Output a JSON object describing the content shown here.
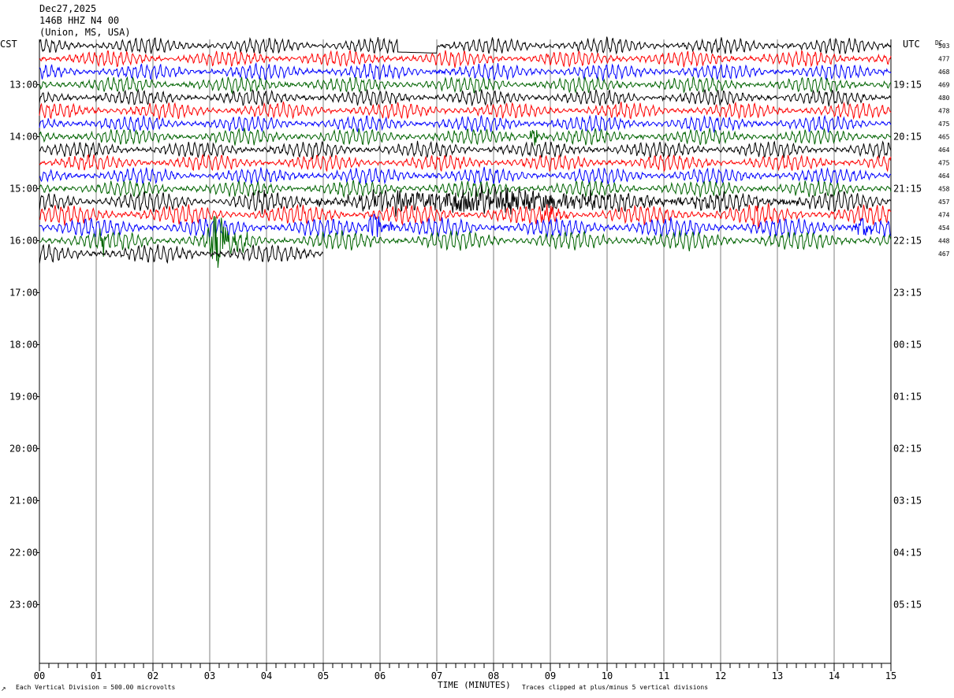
{
  "header": {
    "date": "Dec27,2025",
    "station": "146B HHZ N4 00",
    "location": "(Union, MS, USA)"
  },
  "left_axis_label": "CST",
  "right_axis_label": "UTC",
  "dc_label": "DC",
  "footer": {
    "scale_note": "Each Vertical Division =  500.00 microvolts",
    "clip_note": "Traces clipped at plus/minus 5 vertical divisions",
    "xlabel": "TIME (MINUTES)",
    "corner_mark": "↗"
  },
  "colors": {
    "trace_cycle": [
      "#000000",
      "#ff0000",
      "#0000ff",
      "#006400"
    ],
    "grid": "#808080",
    "text": "#000000"
  },
  "chart_data": {
    "type": "line",
    "title": "Dec27,2025 146B HHZ N4 00 (Union, MS, USA)",
    "xlabel": "TIME (MINUTES)",
    "xlim": [
      0,
      15
    ],
    "x_ticks": [
      "00",
      "01",
      "02",
      "03",
      "04",
      "05",
      "06",
      "07",
      "08",
      "09",
      "10",
      "11",
      "12",
      "13",
      "14",
      "15"
    ],
    "left_hour_labels": [
      "13:00",
      "14:00",
      "15:00",
      "16:00",
      "17:00",
      "18:00",
      "19:00",
      "20:00",
      "21:00",
      "22:00",
      "23:00"
    ],
    "right_hour_labels": [
      "19:15",
      "20:15",
      "21:15",
      "22:15",
      "23:15",
      "00:15",
      "01:15",
      "02:15",
      "03:15",
      "04:15",
      "05:15"
    ],
    "first_row_start_cst": "12:15",
    "minutes_per_row": 15,
    "rows_per_hour": 4,
    "total_rows": 48,
    "dc_offsets": [
      "503",
      "477",
      "468",
      "469",
      "480",
      "478",
      "475",
      "465",
      "464",
      "475",
      "464",
      "458",
      "457",
      "474",
      "454",
      "448",
      "467"
    ],
    "record_end_minute_last_row": 5.0,
    "events": [
      {
        "row": 7,
        "start_min": 8.6,
        "end_min": 8.95,
        "amplitude": 1.2,
        "color": "red"
      },
      {
        "row": 12,
        "start_min": 3.7,
        "end_min": 4.3,
        "amplitude": 1.0,
        "color": "black"
      },
      {
        "row": 12,
        "start_min": 4.85,
        "end_min": 14.2,
        "amplitude": 1.6,
        "color": "black"
      },
      {
        "row": 13,
        "start_min": 8.8,
        "end_min": 9.3,
        "amplitude": 1.6,
        "color": "red"
      },
      {
        "row": 13,
        "start_min": 12.5,
        "end_min": 12.9,
        "amplitude": 1.2,
        "color": "red"
      },
      {
        "row": 14,
        "start_min": 5.75,
        "end_min": 6.25,
        "amplitude": 2.5,
        "color": "blue"
      },
      {
        "row": 14,
        "start_min": 14.3,
        "end_min": 14.95,
        "amplitude": 1.2,
        "color": "blue"
      },
      {
        "row": 15,
        "start_min": 2.95,
        "end_min": 3.7,
        "amplitude": 4.5,
        "color": "green"
      },
      {
        "row": 15,
        "start_min": 1.0,
        "end_min": 1.5,
        "amplitude": 1.0,
        "color": "green"
      }
    ],
    "gap": {
      "row": 0,
      "start_min": 6.3,
      "end_min": 7.0
    }
  }
}
